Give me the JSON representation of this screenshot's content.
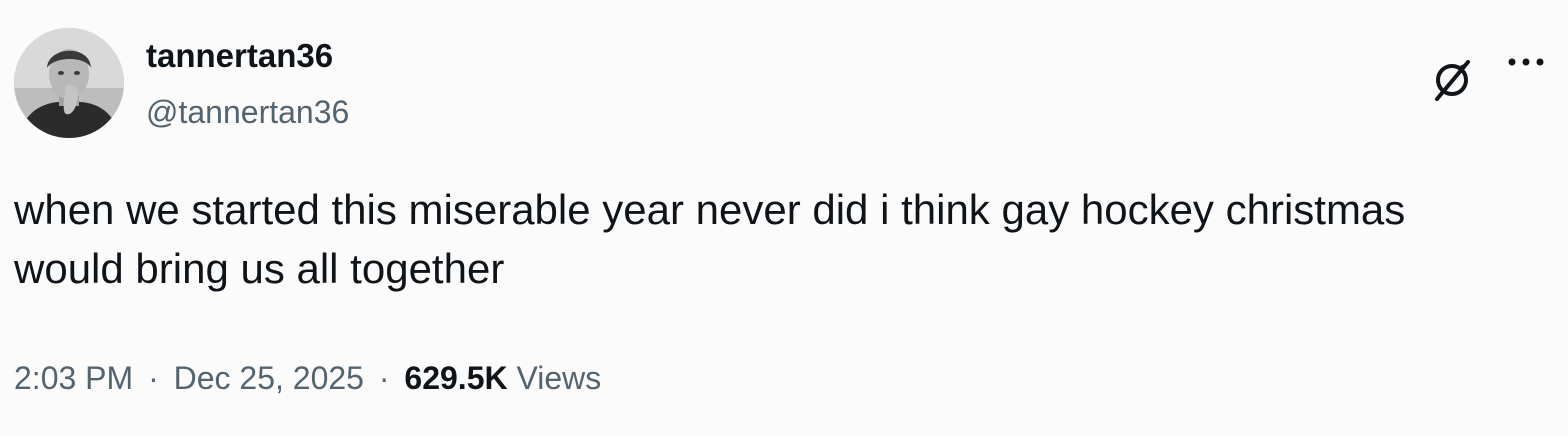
{
  "author": {
    "display_name": "tannertan36",
    "handle": "@tannertan36"
  },
  "tweet": {
    "text": "when we started this miserable year never did i think gay hockey christmas would bring us all together"
  },
  "meta": {
    "time": "2:03 PM",
    "separator": "·",
    "date": "Dec 25, 2025",
    "views_count": "629.5K",
    "views_label": "Views"
  },
  "icons": {
    "grok": "grok-icon",
    "more": "more-icon"
  },
  "colors": {
    "background": "#fbfbfc",
    "primary_text": "#0f1419",
    "secondary_text": "#536471"
  }
}
